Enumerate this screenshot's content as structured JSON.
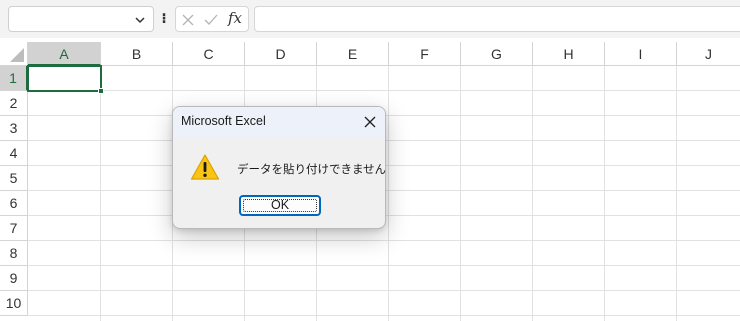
{
  "formula_bar": {
    "name_box_value": "",
    "formula_value": "",
    "fx_label": "fx"
  },
  "grid": {
    "columns": [
      "A",
      "B",
      "C",
      "D",
      "E",
      "F",
      "G",
      "H",
      "I",
      "J"
    ],
    "rows": [
      "1",
      "2",
      "3",
      "4",
      "5",
      "6",
      "7",
      "8",
      "9",
      "10"
    ],
    "active_cell": "A1"
  },
  "dialog": {
    "title": "Microsoft Excel",
    "message": "データを貼り付けできません。",
    "ok_label": "OK",
    "icon": "warning-icon"
  },
  "colors": {
    "selection_green": "#1e6b3f",
    "ok_border_blue": "#0067c0",
    "warning_yellow": "#f9c414"
  }
}
